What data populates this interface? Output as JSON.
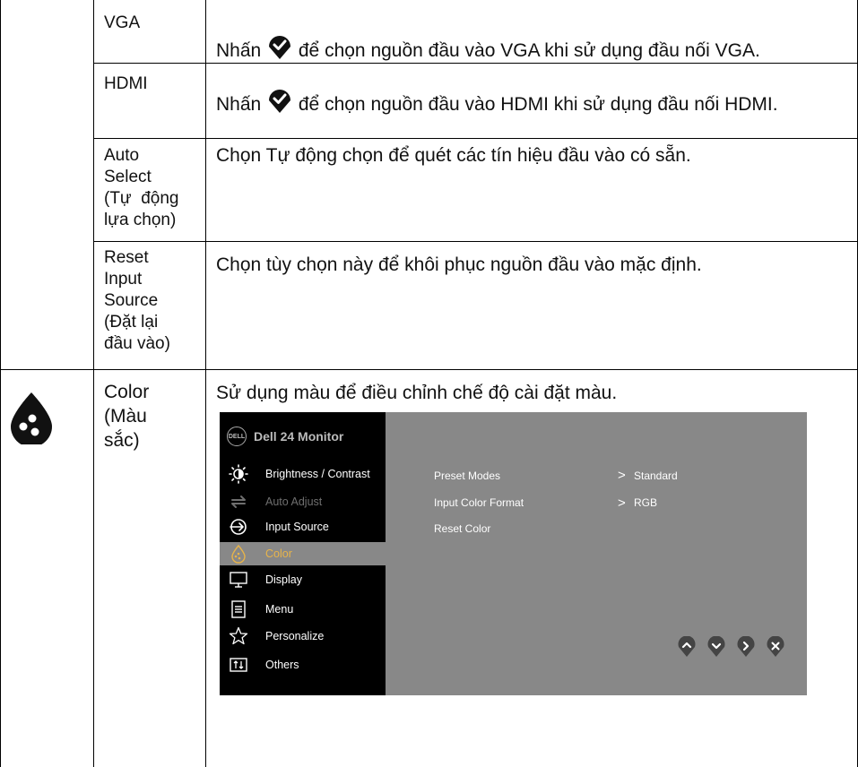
{
  "rows": [
    {
      "label_lines": [
        "VGA"
      ],
      "desc_prefix": "Nhấn ",
      "desc_suffix": " để chọn nguồn đầu vào VGA khi sử dụng  đầu nối VGA."
    },
    {
      "label_lines": [
        "HDMI"
      ],
      "desc_prefix": "Nhấn ",
      "desc_suffix": " để chọn nguồn đầu vào HDMI khi sử dụng  đầu nối HDMI."
    },
    {
      "label_lines": [
        "Auto",
        "Select",
        "(Tự  động",
        "lựa chọn)"
      ],
      "desc": "Chọn Tự động chọn để quét các tín hiệu đầu vào có sẵn."
    },
    {
      "label_lines": [
        "Reset",
        "Input",
        "Source",
        "(Đặt lại",
        "đầu vào)"
      ],
      "desc": "Chọn tùy chọn này để khôi phục nguồn đầu vào mặc định."
    },
    {
      "label_lines": [
        "Color",
        "(Màu",
        "sắc)"
      ],
      "desc": "Sử dụng màu để điều chỉnh chế độ cài đặt màu."
    }
  ],
  "osd": {
    "logo": "DELL",
    "title": "Dell 24 Monitor",
    "menu": [
      {
        "label": "Brightness / Contrast",
        "icon": "brightness-icon",
        "state": "normal"
      },
      {
        "label": "Auto Adjust",
        "icon": "auto-adjust-icon",
        "state": "dim"
      },
      {
        "label": "Input Source",
        "icon": "input-source-icon",
        "state": "normal"
      },
      {
        "label": "Color",
        "icon": "color-icon",
        "state": "active"
      },
      {
        "label": "Display",
        "icon": "display-icon",
        "state": "normal"
      },
      {
        "label": "Menu",
        "icon": "menu-icon",
        "state": "normal"
      },
      {
        "label": "Personalize",
        "icon": "star-icon",
        "state": "normal"
      },
      {
        "label": "Others",
        "icon": "others-icon",
        "state": "normal"
      }
    ],
    "options": [
      {
        "label": "Preset Modes",
        "value": "Standard"
      },
      {
        "label": "Input Color Format",
        "value": "RGB"
      },
      {
        "label": "Reset Color",
        "value": ""
      }
    ],
    "option_arrow": ">",
    "accent_color": "#e8b44a"
  },
  "nav_buttons": [
    "up-button",
    "down-button",
    "right-button",
    "close-button"
  ]
}
